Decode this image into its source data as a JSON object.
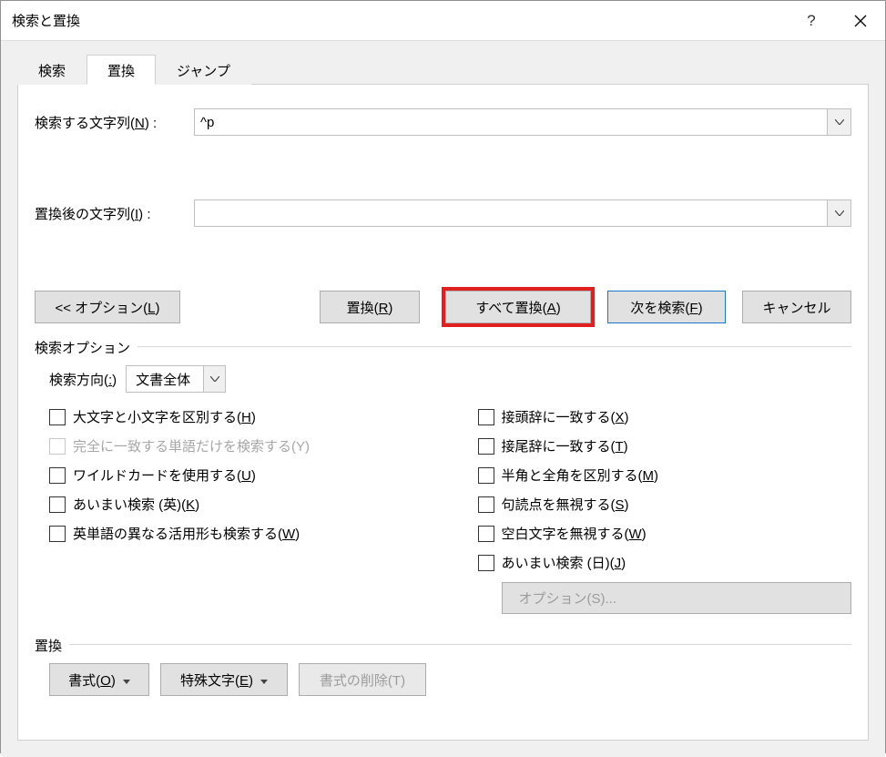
{
  "title": "検索と置換",
  "tabs": {
    "find": "検索",
    "replace": "置換",
    "jump": "ジャンプ",
    "active": "replace"
  },
  "labels": {
    "findWhat": "検索する文字列(N) :",
    "replaceWith": "置換後の文字列(I) :"
  },
  "fields": {
    "findValue": "^p",
    "replaceValue": ""
  },
  "buttons": {
    "options": "<< オプション(L)",
    "replace": "置換(R)",
    "replaceAll": "すべて置換(A)",
    "findNext": "次を検索(F)",
    "cancel": "キャンセル"
  },
  "searchOptions": {
    "legend": "検索オプション",
    "directionLabel": "検索方向(:)",
    "directionValue": "文書全体",
    "left": {
      "matchCase": "大文字と小文字を区別する(H)",
      "wholeWord": "完全に一致する単語だけを検索する(Y)",
      "wildcards": "ワイルドカードを使用する(U)",
      "soundsLike": "あいまい検索 (英)(K)",
      "wordForms": "英単語の異なる活用形も検索する(W)"
    },
    "right": {
      "prefix": "接頭辞に一致する(X)",
      "suffix": "接尾辞に一致する(T)",
      "halfFull": "半角と全角を区別する(M)",
      "ignorePunct": "句読点を無視する(S)",
      "ignoreSpace": "空白文字を無視する(W)",
      "fuzzyJa": "あいまい検索 (日)(J)",
      "optionsBtn": "オプション(S)..."
    }
  },
  "replaceSection": {
    "legend": "置換",
    "format": "書式(O)",
    "special": "特殊文字(E)",
    "noFormat": "書式の削除(T)"
  }
}
